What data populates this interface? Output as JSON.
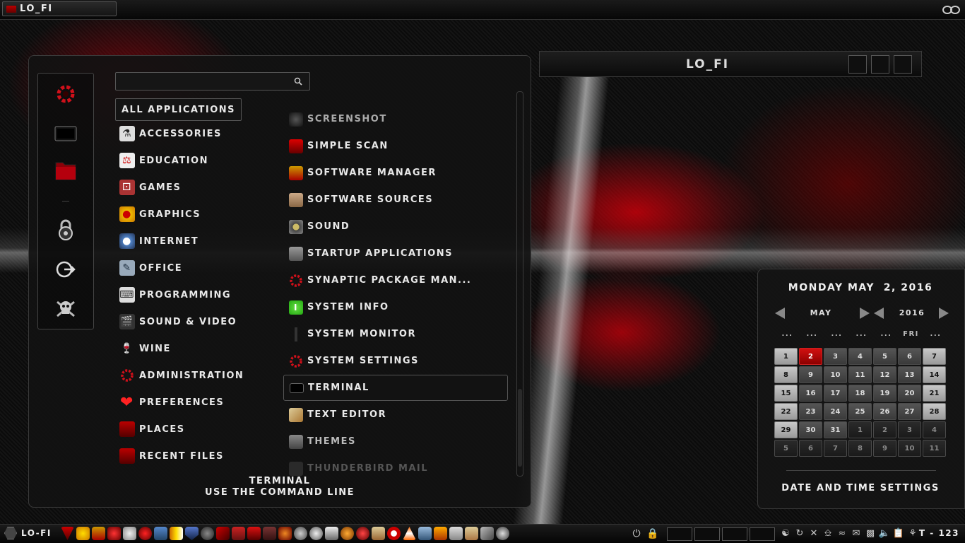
{
  "top_panel": {
    "window_title": "LO_FI"
  },
  "menu": {
    "search": {
      "placeholder": ""
    },
    "categories": [
      {
        "label": "All Applications",
        "icon": "all-apps-icon"
      },
      {
        "label": "Accessories",
        "icon": "accessories-icon"
      },
      {
        "label": "Education",
        "icon": "education-icon"
      },
      {
        "label": "Games",
        "icon": "games-icon"
      },
      {
        "label": "Graphics",
        "icon": "graphics-icon"
      },
      {
        "label": "Internet",
        "icon": "internet-icon"
      },
      {
        "label": "Office",
        "icon": "office-icon"
      },
      {
        "label": "Programming",
        "icon": "programming-icon"
      },
      {
        "label": "Sound & Video",
        "icon": "sound-video-icon"
      },
      {
        "label": "Wine",
        "icon": "wine-icon"
      },
      {
        "label": "Administration",
        "icon": "administration-icon"
      },
      {
        "label": "Preferences",
        "icon": "heart-icon"
      },
      {
        "label": "Places",
        "icon": "folder-icon"
      },
      {
        "label": "Recent Files",
        "icon": "folder-icon"
      }
    ],
    "apps": [
      {
        "label": "Screenshot",
        "icon": "screenshot-icon"
      },
      {
        "label": "Simple Scan",
        "icon": "scanner-icon"
      },
      {
        "label": "Software Manager",
        "icon": "software-manager-icon"
      },
      {
        "label": "Software Sources",
        "icon": "software-sources-icon"
      },
      {
        "label": "Sound",
        "icon": "sound-icon"
      },
      {
        "label": "Startup Applications",
        "icon": "startup-icon"
      },
      {
        "label": "Synaptic Package Man...",
        "icon": "synaptic-icon"
      },
      {
        "label": "System Info",
        "icon": "info-icon"
      },
      {
        "label": "System Monitor",
        "icon": "monitor-icon"
      },
      {
        "label": "System Settings",
        "icon": "settings-icon"
      },
      {
        "label": "Terminal",
        "icon": "terminal-icon"
      },
      {
        "label": "Text Editor",
        "icon": "text-editor-icon"
      },
      {
        "label": "Themes",
        "icon": "themes-icon"
      },
      {
        "label": "Thunderbird Mail",
        "icon": "thunderbird-icon"
      }
    ],
    "description": {
      "title": "Terminal",
      "subtitle": "Use the command line"
    }
  },
  "window_panel": {
    "title": "LO_FI"
  },
  "calendar": {
    "date_heading": "Monday May  2, 2016",
    "month": "May",
    "year": "2016",
    "weekdays": [
      "...",
      "...",
      "...",
      "...",
      "...",
      "Fri",
      "..."
    ],
    "days": [
      {
        "n": "1",
        "t": "light"
      },
      {
        "n": "2",
        "t": "today"
      },
      {
        "n": "3",
        "t": "mid"
      },
      {
        "n": "4",
        "t": "mid"
      },
      {
        "n": "5",
        "t": "mid"
      },
      {
        "n": "6",
        "t": "mid"
      },
      {
        "n": "7",
        "t": "light"
      },
      {
        "n": "8",
        "t": "light"
      },
      {
        "n": "9",
        "t": "mid"
      },
      {
        "n": "10",
        "t": "mid"
      },
      {
        "n": "11",
        "t": "mid"
      },
      {
        "n": "12",
        "t": "mid"
      },
      {
        "n": "13",
        "t": "mid"
      },
      {
        "n": "14",
        "t": "light"
      },
      {
        "n": "15",
        "t": "light"
      },
      {
        "n": "16",
        "t": "mid"
      },
      {
        "n": "17",
        "t": "mid"
      },
      {
        "n": "18",
        "t": "mid"
      },
      {
        "n": "19",
        "t": "mid"
      },
      {
        "n": "20",
        "t": "mid"
      },
      {
        "n": "21",
        "t": "light"
      },
      {
        "n": "22",
        "t": "light"
      },
      {
        "n": "23",
        "t": "mid"
      },
      {
        "n": "24",
        "t": "mid"
      },
      {
        "n": "25",
        "t": "mid"
      },
      {
        "n": "26",
        "t": "mid"
      },
      {
        "n": "27",
        "t": "mid"
      },
      {
        "n": "28",
        "t": "light"
      },
      {
        "n": "29",
        "t": "light"
      },
      {
        "n": "30",
        "t": "mid"
      },
      {
        "n": "31",
        "t": "mid"
      },
      {
        "n": "1",
        "t": "other"
      },
      {
        "n": "2",
        "t": "other"
      },
      {
        "n": "3",
        "t": "other"
      },
      {
        "n": "4",
        "t": "other"
      },
      {
        "n": "5",
        "t": "other"
      },
      {
        "n": "6",
        "t": "other"
      },
      {
        "n": "7",
        "t": "other"
      },
      {
        "n": "8",
        "t": "other"
      },
      {
        "n": "9",
        "t": "other"
      },
      {
        "n": "10",
        "t": "other"
      },
      {
        "n": "11",
        "t": "other"
      }
    ],
    "settings_label": "Date and Time Settings"
  },
  "bottom_panel": {
    "menu_label": "LO-FI",
    "clock": "T - 123"
  },
  "colors": {
    "accent": "#c80a10",
    "panel": "#121212"
  }
}
